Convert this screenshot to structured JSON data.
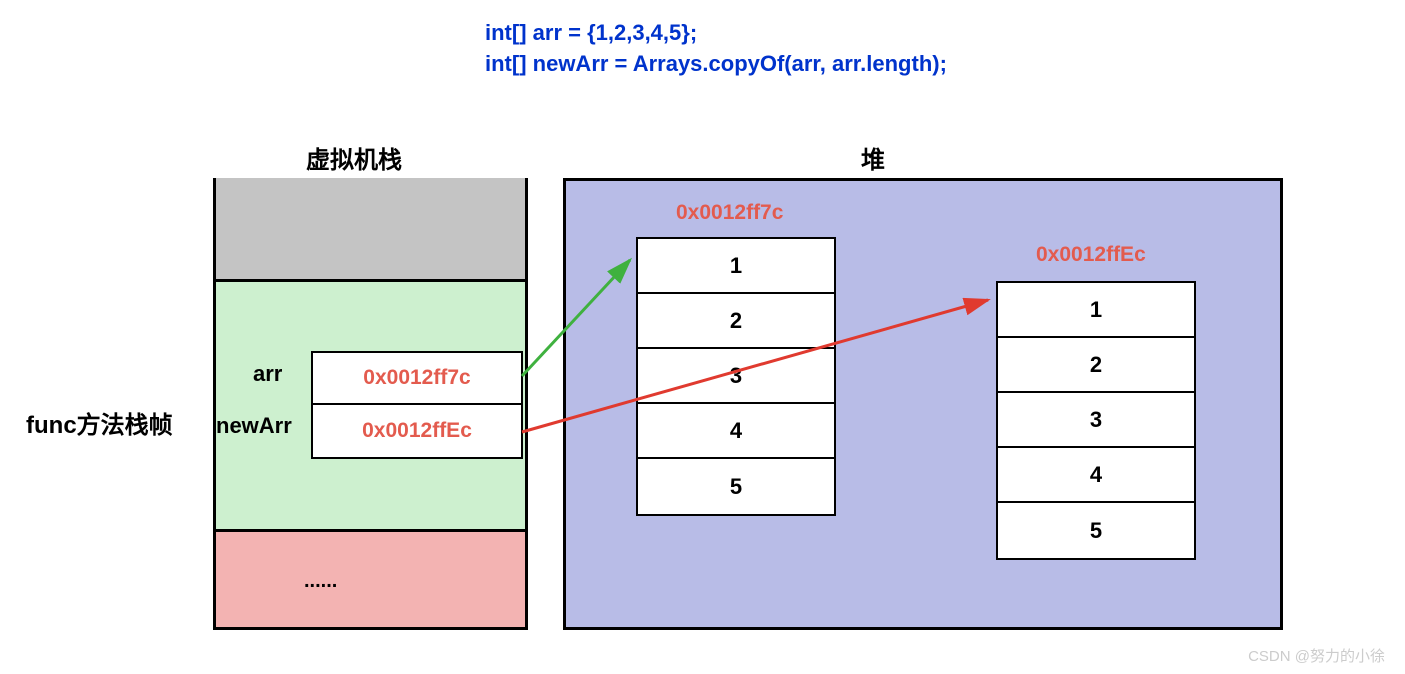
{
  "code": {
    "line1": "int[] arr = {1,2,3,4,5};",
    "line2": "int[] newArr = Arrays.copyOf(arr, arr.length);"
  },
  "labels": {
    "stack_title": "虚拟机栈",
    "heap_title": "堆",
    "func_frame": "func方法栈帧",
    "dots": "......"
  },
  "vars": {
    "arr_name": "arr",
    "arr_value": "0x0012ff7c",
    "newarr_name": "newArr",
    "newarr_value": "0x0012ffEc"
  },
  "heap": {
    "addr1": "0x0012ff7c",
    "addr2": "0x0012ffEc",
    "arr1": [
      "1",
      "2",
      "3",
      "4",
      "5"
    ],
    "arr2": [
      "1",
      "2",
      "3",
      "4",
      "5"
    ]
  },
  "watermark": "CSDN @努力的小徐"
}
